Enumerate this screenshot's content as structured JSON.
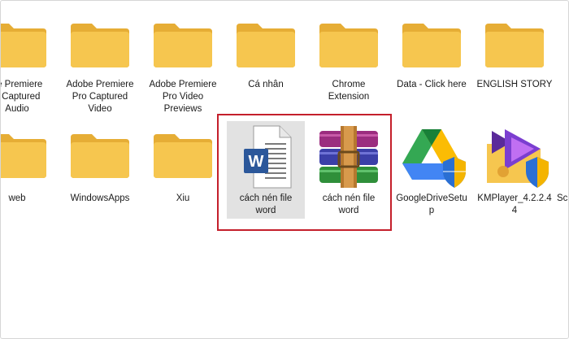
{
  "window": {
    "title": ""
  },
  "row1": [
    {
      "name": "Adobe Premiere\nPro Captured\nAudio",
      "label_visible": "be Premiere\no Captured\nAudio"
    },
    {
      "name": "Adobe Premiere\nPro Captured\nVideo"
    },
    {
      "name": "Adobe Premiere\nPro Video\nPreviews"
    },
    {
      "name": "Cá nhân"
    },
    {
      "name": "Chrome\nExtension"
    },
    {
      "name": "Data - Click here"
    },
    {
      "name": "ENGLISH STORY"
    }
  ],
  "row2": [
    {
      "name": "web"
    },
    {
      "name": "WindowsApps"
    },
    {
      "name": "Xiu"
    },
    {
      "name": "cách nén file\nword",
      "type": "word-doc"
    },
    {
      "name": "cách nén file\nword",
      "type": "rar-archive"
    },
    {
      "name": "GoogleDriveSetu\np",
      "type": "installer"
    },
    {
      "name": "KMPlayer_4.2.2.4\n4",
      "type": "installer"
    },
    {
      "name": "Sc"
    }
  ],
  "colors": {
    "folder": "#f6c64f",
    "folder_dark": "#e6ad35",
    "highlight": "#c41f2b",
    "selected": "#e2e2e2",
    "word_blue": "#2b579a"
  }
}
